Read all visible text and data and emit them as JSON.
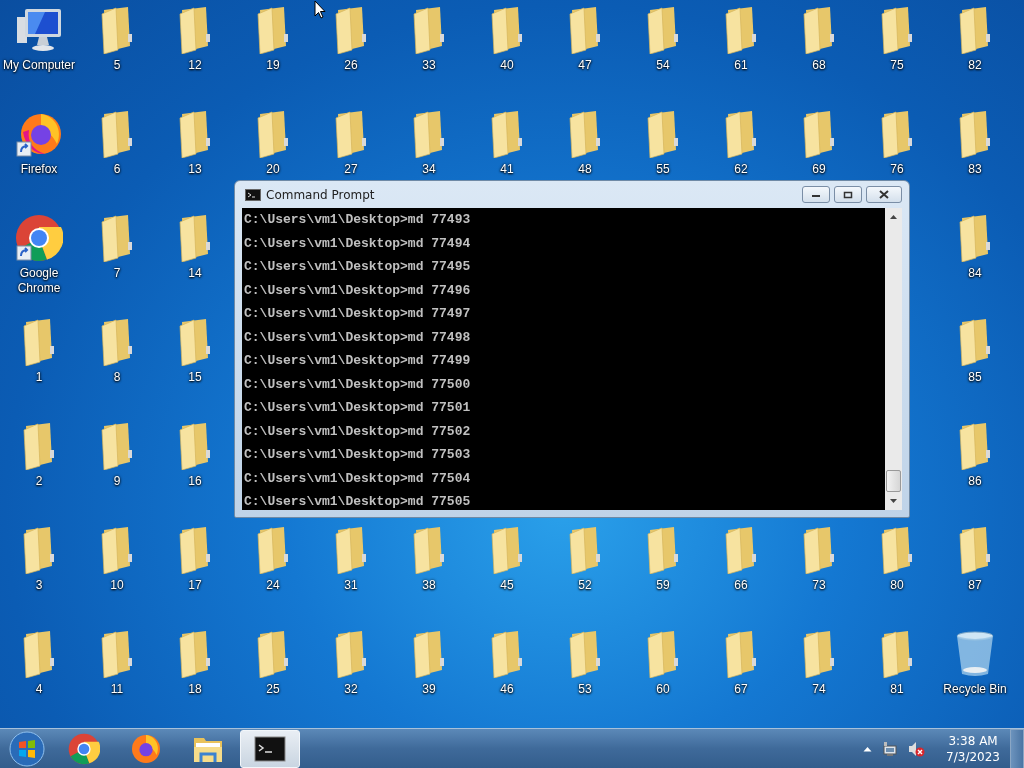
{
  "desktop": {
    "icons": [
      {
        "kind": "computer",
        "label": "My Computer"
      },
      {
        "kind": "firefox",
        "label": "Firefox"
      },
      {
        "kind": "chrome",
        "label": "Google Chrome"
      },
      {
        "kind": "folder",
        "label": "1"
      },
      {
        "kind": "folder",
        "label": "2"
      },
      {
        "kind": "folder",
        "label": "3"
      },
      {
        "kind": "folder",
        "label": "4"
      },
      {
        "kind": "folder",
        "label": "5"
      },
      {
        "kind": "folder",
        "label": "6"
      },
      {
        "kind": "folder",
        "label": "7"
      },
      {
        "kind": "folder",
        "label": "8"
      },
      {
        "kind": "folder",
        "label": "9"
      },
      {
        "kind": "folder",
        "label": "10"
      },
      {
        "kind": "folder",
        "label": "11"
      },
      {
        "kind": "folder",
        "label": "12"
      },
      {
        "kind": "folder",
        "label": "13"
      },
      {
        "kind": "folder",
        "label": "14"
      },
      {
        "kind": "folder",
        "label": "15"
      },
      {
        "kind": "folder",
        "label": "16"
      },
      {
        "kind": "folder",
        "label": "17"
      },
      {
        "kind": "folder",
        "label": "18"
      },
      {
        "kind": "folder",
        "label": "19"
      },
      {
        "kind": "folder",
        "label": "20"
      },
      {
        "kind": "folder",
        "label": "24"
      },
      {
        "kind": "folder",
        "label": "25"
      },
      {
        "kind": "folder",
        "label": "26"
      },
      {
        "kind": "folder",
        "label": "27"
      },
      {
        "kind": "folder",
        "label": "31"
      },
      {
        "kind": "folder",
        "label": "32"
      },
      {
        "kind": "folder",
        "label": "33"
      },
      {
        "kind": "folder",
        "label": "34"
      },
      {
        "kind": "folder",
        "label": "38"
      },
      {
        "kind": "folder",
        "label": "39"
      },
      {
        "kind": "folder",
        "label": "40"
      },
      {
        "kind": "folder",
        "label": "41"
      },
      {
        "kind": "folder",
        "label": "45"
      },
      {
        "kind": "folder",
        "label": "46"
      },
      {
        "kind": "folder",
        "label": "47"
      },
      {
        "kind": "folder",
        "label": "48"
      },
      {
        "kind": "folder",
        "label": "52"
      },
      {
        "kind": "folder",
        "label": "53"
      },
      {
        "kind": "folder",
        "label": "54"
      },
      {
        "kind": "folder",
        "label": "55"
      },
      {
        "kind": "folder",
        "label": "59"
      },
      {
        "kind": "folder",
        "label": "60"
      },
      {
        "kind": "folder",
        "label": "61"
      },
      {
        "kind": "folder",
        "label": "62"
      },
      {
        "kind": "folder",
        "label": "66"
      },
      {
        "kind": "folder",
        "label": "67"
      },
      {
        "kind": "folder",
        "label": "68"
      },
      {
        "kind": "folder",
        "label": "69"
      },
      {
        "kind": "folder",
        "label": "73"
      },
      {
        "kind": "folder",
        "label": "74"
      },
      {
        "kind": "folder",
        "label": "75"
      },
      {
        "kind": "folder",
        "label": "76"
      },
      {
        "kind": "folder",
        "label": "80"
      },
      {
        "kind": "folder",
        "label": "81"
      },
      {
        "kind": "folder",
        "label": "82"
      },
      {
        "kind": "folder",
        "label": "83"
      },
      {
        "kind": "folder",
        "label": "84"
      },
      {
        "kind": "folder",
        "label": "85"
      },
      {
        "kind": "folder",
        "label": "86"
      },
      {
        "kind": "folder",
        "label": "87"
      },
      {
        "kind": "recycle-bin",
        "label": "Recycle Bin"
      }
    ]
  },
  "window": {
    "title": "Command Prompt",
    "lines": [
      "C:\\Users\\vm1\\Desktop>md 77493",
      "C:\\Users\\vm1\\Desktop>md 77494",
      "C:\\Users\\vm1\\Desktop>md 77495",
      "C:\\Users\\vm1\\Desktop>md 77496",
      "C:\\Users\\vm1\\Desktop>md 77497",
      "C:\\Users\\vm1\\Desktop>md 77498",
      "C:\\Users\\vm1\\Desktop>md 77499",
      "C:\\Users\\vm1\\Desktop>md 77500",
      "C:\\Users\\vm1\\Desktop>md 77501",
      "C:\\Users\\vm1\\Desktop>md 77502",
      "C:\\Users\\vm1\\Desktop>md 77503",
      "C:\\Users\\vm1\\Desktop>md 77504",
      "C:\\Users\\vm1\\Desktop>md 77505"
    ]
  },
  "taskbar": {
    "items": [
      {
        "kind": "chrome",
        "selected": false
      },
      {
        "kind": "firefox",
        "selected": false
      },
      {
        "kind": "explorer",
        "selected": false
      },
      {
        "kind": "cmd",
        "selected": true
      }
    ],
    "clock": {
      "time": "3:38 AM",
      "date": "7/3/2023"
    }
  }
}
